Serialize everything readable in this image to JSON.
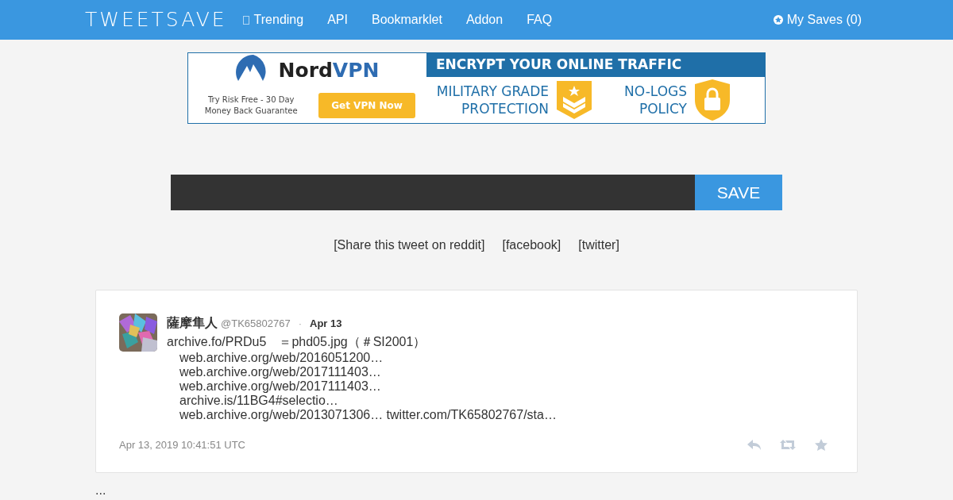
{
  "navbar": {
    "logo": "TWEETSAVE",
    "links": [
      {
        "label": "Trending",
        "icon": true
      },
      {
        "label": "API",
        "icon": false
      },
      {
        "label": "Bookmarklet",
        "icon": false
      },
      {
        "label": "Addon",
        "icon": false
      },
      {
        "label": "FAQ",
        "icon": false
      }
    ],
    "my_saves": "My Saves (0)"
  },
  "ad": {
    "brand_a": "Nord",
    "brand_b": "VPN",
    "tagline": "Try Risk Free - 30 Day Money Back Guarantee",
    "cta": "Get VPN Now",
    "headline": "ENCRYPT YOUR ONLINE TRAFFIC",
    "feature_1": "MILITARY GRADE PROTECTION",
    "feature_2": "NO-LOGS POLICY"
  },
  "save_form": {
    "button": "SAVE"
  },
  "share_links": [
    "[Share this tweet on reddit]",
    "[facebook]",
    "[twitter]"
  ],
  "tweet": {
    "name": "薩摩隼人",
    "handle": "@TK65802767",
    "separator": "·",
    "date": "Apr 13",
    "lines": [
      "archive.fo/PRDu5　＝phd05.jpg（＃SI2001）",
      "web.archive.org/web/2016051200…",
      "web.archive.org/web/2017111403…",
      "web.archive.org/web/2017111403…",
      "archive.is/11BG4#selectio…",
      "web.archive.org/web/2013071306… twitter.com/TK65802767/sta…"
    ],
    "timestamp": "Apr 13, 2019 10:41:51 UTC"
  },
  "footer_text": "..."
}
